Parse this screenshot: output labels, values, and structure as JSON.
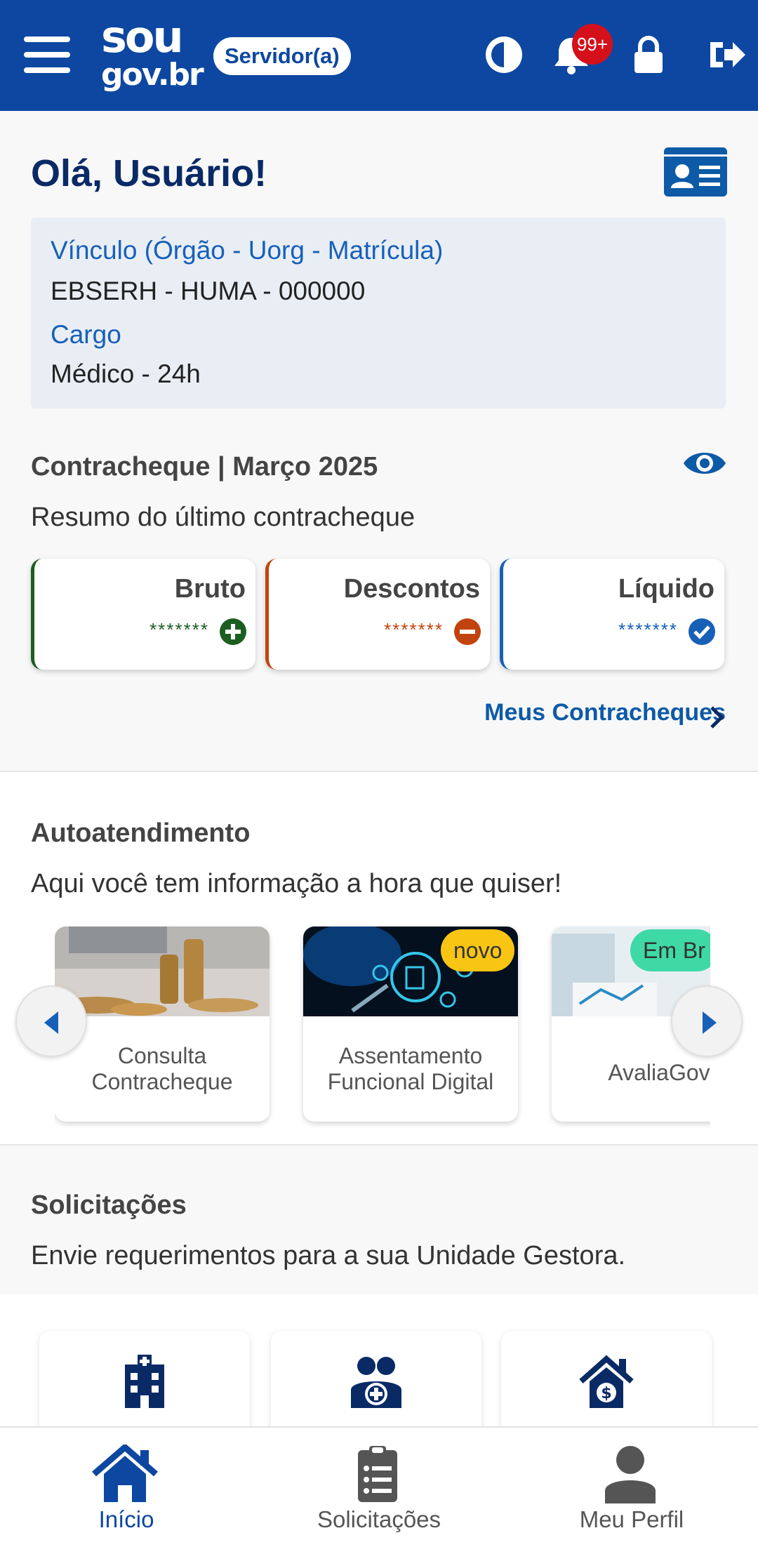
{
  "header": {
    "logo_line1": "sou",
    "logo_line2": "gov.br",
    "role": "Servidor(a)",
    "notification_count": "99+",
    "brand_color": "#0d47a1"
  },
  "greeting": "Olá, Usuário!",
  "link": {
    "label": "Vínculo (Órgão - Uorg - Matrícula)",
    "value": "EBSERH - HUMA - 000000",
    "position_label": "Cargo",
    "position_value": "Médico - 24h"
  },
  "payslip": {
    "title": "Contracheque | Março 2025",
    "subtitle": "Resumo do último contracheque",
    "cards": [
      {
        "label": "Bruto",
        "value": "*******",
        "color": "#1b5e20",
        "icon": "plus-circle-icon"
      },
      {
        "label": "Descontos",
        "value": "*******",
        "color": "#c1440e",
        "icon": "minus-circle-icon"
      },
      {
        "label": "Líquido",
        "value": "*******",
        "color": "#1760b8",
        "icon": "check-circle-icon"
      }
    ],
    "link": "Meus Contracheques"
  },
  "self_service": {
    "title": "Autoatendimento",
    "subtitle": "Aqui você tem informação a hora que quiser!",
    "items": [
      {
        "name": "Consulta Contracheque",
        "tag": ""
      },
      {
        "name": "Assentamento Funcional Digital",
        "tag": "novo",
        "tag_color": "#f9c513"
      },
      {
        "name": "AvaliaGov",
        "tag": "Em Br",
        "tag_color": "#3fd9a6"
      }
    ]
  },
  "requests": {
    "title": "Solicitações",
    "subtitle": "Envie requerimentos para a sua Unidade Gestora.",
    "icons": [
      "hospital-icon",
      "family-health-icon",
      "house-money-icon"
    ]
  },
  "bottom_nav": [
    {
      "label": "Início",
      "active": true
    },
    {
      "label": "Solicitações",
      "active": false
    },
    {
      "label": "Meu Perfil",
      "active": false
    }
  ]
}
